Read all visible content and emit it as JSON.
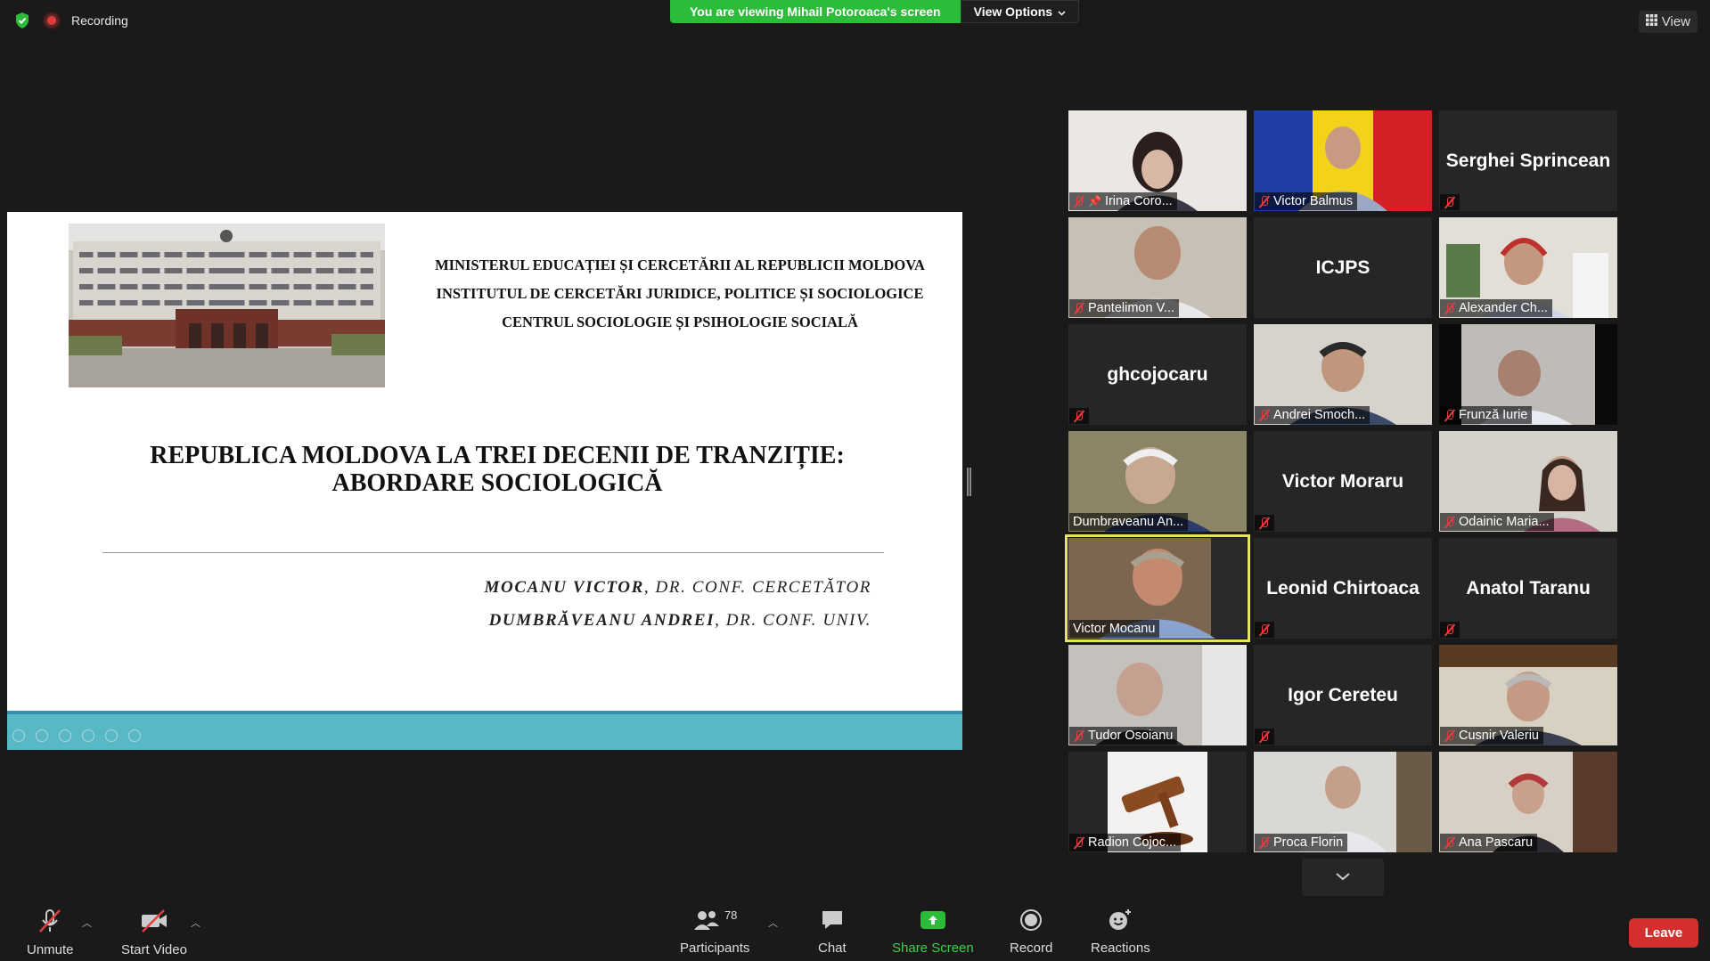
{
  "top": {
    "recording_label": "Recording",
    "banner_text": "You are viewing Mihail Potoroaca's screen",
    "view_options_label": "View Options",
    "view_label": "View"
  },
  "slide": {
    "institution": [
      "MINISTERUL EDUCAȚIEI ȘI CERCETĂRII AL REPUBLICII MOLDOVA",
      "INSTITUTUL DE CERCETĂRI JURIDICE, POLITICE ȘI SOCIOLOGICE",
      "CENTRUL SOCIOLOGIE ȘI PSIHOLOGIE SOCIALĂ"
    ],
    "title_line1": "REPUBLICA MOLDOVA LA TREI DECENII DE TRANZIȚIE:",
    "title_line2": "ABORDARE SOCIOLOGICĂ",
    "authors": [
      {
        "name": "MOCANU VICTOR",
        "role": ", DR. CONF. CERCETĂTOR"
      },
      {
        "name": "DUMBRĂVEANU ANDREI",
        "role": ", DR. CONF. UNIV."
      }
    ]
  },
  "participants": [
    {
      "name": "Irina Coro...",
      "muted": true,
      "pinned": true
    },
    {
      "name": "Victor Balmus",
      "muted": true
    },
    {
      "name": "Serghei Sprincean",
      "muted": true
    },
    {
      "name": "Pantelimon V...",
      "muted": true
    },
    {
      "name": "ICJPS",
      "muted": false
    },
    {
      "name": "Alexander Ch...",
      "muted": true
    },
    {
      "name": "ghcojocaru",
      "muted": true
    },
    {
      "name": "Andrei Smoch...",
      "muted": true
    },
    {
      "name": "Frunză Iurie",
      "muted": true
    },
    {
      "name": "Dumbraveanu An...",
      "muted": false
    },
    {
      "name": "Victor Moraru",
      "muted": true
    },
    {
      "name": "Odainic Maria...",
      "muted": true
    },
    {
      "name": "Victor Mocanu",
      "muted": false,
      "active": true
    },
    {
      "name": "Leonid Chirtoaca",
      "muted": true
    },
    {
      "name": "Anatol Taranu",
      "muted": true
    },
    {
      "name": "Tudor Osoianu",
      "muted": true
    },
    {
      "name": "Igor Cereteu",
      "muted": true
    },
    {
      "name": "Cusnir Valeriu",
      "muted": true
    },
    {
      "name": "Radion Cojoc...",
      "muted": true
    },
    {
      "name": "Proca Florin",
      "muted": true
    },
    {
      "name": "Ana Pascaru",
      "muted": true
    }
  ],
  "toolbar": {
    "unmute_label": "Unmute",
    "start_video_label": "Start Video",
    "participants_label": "Participants",
    "participants_count": "78",
    "chat_label": "Chat",
    "share_screen_label": "Share Screen",
    "record_label": "Record",
    "reactions_label": "Reactions",
    "leave_label": "Leave"
  },
  "colors": {
    "share_green": "#2bbd3a",
    "leave_red": "#d32f2f",
    "active_speaker": "#e6e65a",
    "slide_bar": "#58b8c6"
  },
  "icons": {
    "security": "shield-check-icon",
    "recording": "record-dot-icon",
    "view": "grid-icon",
    "mic_muted": "mic-muted-icon",
    "pin": "pin-icon",
    "video_off": "video-off-icon",
    "participants": "people-icon",
    "chat": "chat-bubble-icon",
    "share": "share-arrow-icon",
    "record": "record-circle-icon",
    "reactions": "smiley-plus-icon",
    "scroll_down": "chevron-down-icon"
  }
}
